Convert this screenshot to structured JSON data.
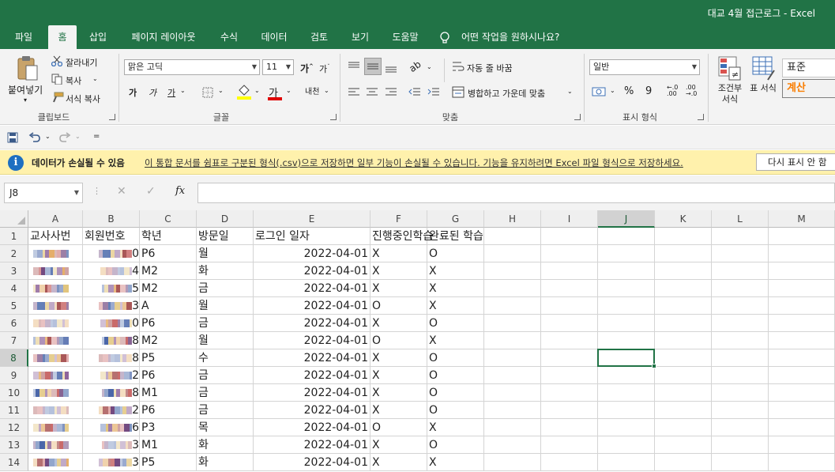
{
  "window": {
    "title": "대교 4월 접근로그  -  Excel"
  },
  "tabs": [
    {
      "label": "파일"
    },
    {
      "label": "홈"
    },
    {
      "label": "삽입"
    },
    {
      "label": "페이지 레이아웃"
    },
    {
      "label": "수식"
    },
    {
      "label": "데이터"
    },
    {
      "label": "검토"
    },
    {
      "label": "보기"
    },
    {
      "label": "도움말"
    }
  ],
  "tell_me": "어떤 작업을 원하시나요?",
  "ribbon": {
    "clipboard": {
      "paste": "붙여넣기",
      "cut": "잘라내기",
      "copy": "복사",
      "format_painter": "서식 복사",
      "label": "클립보드"
    },
    "font": {
      "name": "맑은 고딕",
      "size": "11",
      "label": "글꼴",
      "bold": "가",
      "italic": "가",
      "underline": "가"
    },
    "alignment": {
      "wrap": "자동 줄 바꿈",
      "merge": "병합하고 가운데 맞춤",
      "label": "맞춤"
    },
    "number": {
      "format": "일반",
      "label": "표시 형식",
      "percent": "%",
      "comma": "9"
    },
    "styles": {
      "conditional": "조건부 서식",
      "table": "표 서식",
      "normal": "표준",
      "calc": "계산"
    }
  },
  "message_bar": {
    "title": "데이터가 손실될 수 있음",
    "text": "이 통합 문서를 쉼표로 구분된 형식(.csv)으로 저장하면 일부 기능이 손실될 수 있습니다. 기능을 유지하려면 Excel 파일 형식으로 저장하세요.",
    "button": "다시 표시 안 함"
  },
  "formula_bar": {
    "name_box": "J8",
    "value": "",
    "fx": "fx"
  },
  "columns": [
    "A",
    "B",
    "C",
    "D",
    "E",
    "F",
    "G",
    "H",
    "I",
    "J",
    "K",
    "L",
    "M"
  ],
  "selected_cell": "J8",
  "headers": {
    "A": "교사사번",
    "B": "회원번호",
    "C": "학년",
    "D": "방문일",
    "E": "로그인 일자",
    "F": "진행중인학습",
    "G": "완료된 학습"
  },
  "rows": [
    {
      "num": "1"
    },
    {
      "num": "2",
      "a_suffix": "",
      "b_suffix": "0",
      "c": "P6",
      "d": "월",
      "e": "2022-04-01",
      "f": "X",
      "g": "O"
    },
    {
      "num": "3",
      "a_suffix": "",
      "b_suffix": "4",
      "c": "M2",
      "d": "화",
      "e": "2022-04-01",
      "f": "X",
      "g": "X"
    },
    {
      "num": "4",
      "a_suffix": "",
      "b_suffix": "5",
      "c": "M2",
      "d": "금",
      "e": "2022-04-01",
      "f": "X",
      "g": "X"
    },
    {
      "num": "5",
      "a_suffix": "",
      "b_suffix": "3",
      "c": "A",
      "d": "월",
      "e": "2022-04-01",
      "f": "O",
      "g": "X"
    },
    {
      "num": "6",
      "a_suffix": "",
      "b_suffix": "0",
      "c": "P6",
      "d": "금",
      "e": "2022-04-01",
      "f": "X",
      "g": "O"
    },
    {
      "num": "7",
      "a_suffix": "",
      "b_suffix": "8",
      "c": "M2",
      "d": "월",
      "e": "2022-04-01",
      "f": "O",
      "g": "X"
    },
    {
      "num": "8",
      "a_suffix": "",
      "b_suffix": "8",
      "c": "P5",
      "d": "수",
      "e": "2022-04-01",
      "f": "X",
      "g": "O"
    },
    {
      "num": "9",
      "a_suffix": "",
      "b_suffix": "2",
      "c": "P6",
      "d": "금",
      "e": "2022-04-01",
      "f": "X",
      "g": "O"
    },
    {
      "num": "10",
      "a_suffix": "",
      "b_suffix": "8",
      "c": "M1",
      "d": "금",
      "e": "2022-04-01",
      "f": "X",
      "g": "O"
    },
    {
      "num": "11",
      "a_suffix": "",
      "b_suffix": "2",
      "c": "P6",
      "d": "금",
      "e": "2022-04-01",
      "f": "X",
      "g": "O"
    },
    {
      "num": "12",
      "a_suffix": "",
      "b_suffix": "6",
      "c": "P3",
      "d": "목",
      "e": "2022-04-01",
      "f": "O",
      "g": "X"
    },
    {
      "num": "13",
      "a_suffix": "",
      "b_suffix": "3",
      "c": "M1",
      "d": "화",
      "e": "2022-04-01",
      "f": "X",
      "g": "O"
    },
    {
      "num": "14",
      "a_suffix": "",
      "b_suffix": "3",
      "c": "P5",
      "d": "화",
      "e": "2022-04-01",
      "f": "X",
      "g": "X"
    }
  ],
  "colors": {
    "excel_green": "#217346",
    "message_bar": "#fff1ac",
    "info_blue": "#1e6fc1"
  }
}
